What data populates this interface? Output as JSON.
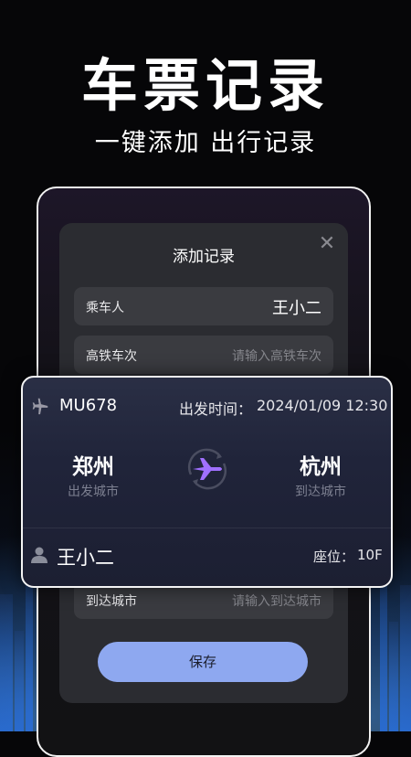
{
  "hero": {
    "title": "车票记录",
    "subtitle": "一键添加 出行记录"
  },
  "modal": {
    "title": "添加记录",
    "close_icon": "close-icon",
    "rows": [
      {
        "label": "乘车人",
        "value": "王小二"
      },
      {
        "label": "高铁车次",
        "placeholder": "请输入高铁车次"
      },
      {
        "label": "到达城市",
        "placeholder": "请输入到达城市"
      }
    ],
    "save_label": "保存"
  },
  "ticket": {
    "flight_icon": "airplane-icon",
    "flight_no": "MU678",
    "departure_label": "出发时间：",
    "departure_time": "2024/01/09 12:30",
    "from_city": "郑州",
    "from_label": "出发城市",
    "to_city": "杭州",
    "to_label": "到达城市",
    "center_icon": "plane-circle-icon",
    "passenger_icon": "person-icon",
    "passenger": "王小二",
    "seat_label": "座位：",
    "seat": "10F"
  },
  "colors": {
    "accent": "#8ea8f0",
    "emblem_purple": "#a070ff",
    "background": "#060608"
  }
}
